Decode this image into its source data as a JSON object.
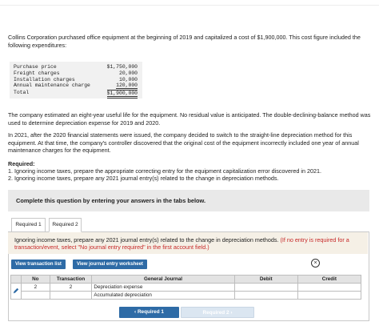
{
  "intro": "Collins Corporation purchased office equipment at the beginning of 2019 and capitalized a cost of $1,900,000. This cost figure included the following expenditures:",
  "costs": [
    {
      "label": "Purchase price",
      "value": "$1,750,000"
    },
    {
      "label": "Freight charges",
      "value": "20,000"
    },
    {
      "label": "Installation charges",
      "value": "10,000"
    },
    {
      "label": "Annual maintenance charge",
      "value": "120,000"
    },
    {
      "label": "Total",
      "value": "$1,900,000"
    }
  ],
  "para1": "The company estimated an eight-year useful life for the equipment. No residual value is anticipated. The double-declining-balance method was used to determine depreciation expense for 2019 and 2020.",
  "para2": "In 2021, after the 2020 financial statements were issued, the company decided to switch to the straight-line depreciation method for this equipment. At that time, the company's controller discovered that the original cost of the equipment incorrectly included one year of annual maintenance charges for the equipment.",
  "required": {
    "heading": "Required:",
    "item1": "1. Ignoring income taxes, prepare the appropriate correcting entry for the equipment capitalization error discovered in 2021.",
    "item2": "2. Ignoring income taxes, prepare any 2021 journal entry(s) related to the change in depreciation methods."
  },
  "banner": "Complete this question by entering your answers in the tabs below.",
  "tabs": [
    "Required 1",
    "Required 2"
  ],
  "instruction": {
    "main": "Ignoring income taxes, prepare any 2021 journal entry(s) related to the change in depreciation methods.",
    "note": "(If no entry is required for a transaction/event, select \"No journal entry required\" in the first account field.)"
  },
  "buttons": {
    "view_transaction": "View transaction list",
    "view_worksheet": "View journal entry worksheet",
    "prev": "Required 1",
    "next": "Required 2"
  },
  "journal": {
    "headers": [
      "No",
      "Transaction",
      "General Journal",
      "Debit",
      "Credit"
    ],
    "rows": [
      {
        "no": "2",
        "transaction": "2",
        "account": "Depreciation expense",
        "debit": "",
        "credit": ""
      },
      {
        "no": "",
        "transaction": "",
        "account": "Accumulated depreciation",
        "debit": "",
        "credit": ""
      }
    ]
  },
  "icons": {
    "edit": "pencil-icon",
    "close": "close-circle-icon",
    "prev": "chevron-left-icon",
    "next": "chevron-right-icon"
  },
  "colors": {
    "accent": "#2e6ba6",
    "note_red": "#c62828",
    "instruction_bg": "#f5f0e6"
  }
}
